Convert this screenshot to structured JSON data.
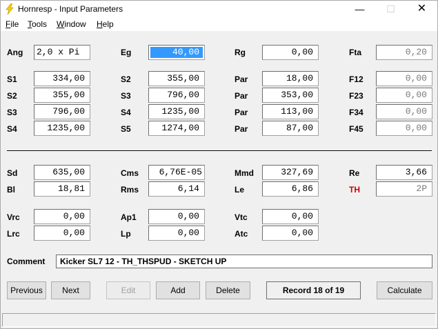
{
  "window": {
    "title": "Hornresp - Input Parameters",
    "min": "—",
    "max": "☐",
    "close": "✕"
  },
  "menu": [
    "File",
    "Tools",
    "Window",
    "Help"
  ],
  "rows": {
    "r1": [
      {
        "label": "Ang",
        "value": "2,0 x Pi"
      },
      {
        "label": "Eg",
        "value": "40,00"
      },
      {
        "label": "Rg",
        "value": "0,00"
      },
      {
        "label": "Fta",
        "value": "0,20"
      }
    ],
    "r2": [
      {
        "label": "S1",
        "value": "334,00"
      },
      {
        "label": "S2",
        "value": "355,00"
      },
      {
        "label": "Par",
        "value": "18,00"
      },
      {
        "label": "F12",
        "value": "0,00"
      }
    ],
    "r3": [
      {
        "label": "S2",
        "value": "355,00"
      },
      {
        "label": "S3",
        "value": "796,00"
      },
      {
        "label": "Par",
        "value": "353,00"
      },
      {
        "label": "F23",
        "value": "0,00"
      }
    ],
    "r4": [
      {
        "label": "S3",
        "value": "796,00"
      },
      {
        "label": "S4",
        "value": "1235,00"
      },
      {
        "label": "Par",
        "value": "113,00"
      },
      {
        "label": "F34",
        "value": "0,00"
      }
    ],
    "r5": [
      {
        "label": "S4",
        "value": "1235,00"
      },
      {
        "label": "S5",
        "value": "1274,00"
      },
      {
        "label": "Par",
        "value": "87,00"
      },
      {
        "label": "F45",
        "value": "0,00"
      }
    ],
    "r6": [
      {
        "label": "Sd",
        "value": "635,00"
      },
      {
        "label": "Cms",
        "value": "6,76E-05"
      },
      {
        "label": "Mmd",
        "value": "327,69"
      },
      {
        "label": "Re",
        "value": "3,66"
      }
    ],
    "r7": [
      {
        "label": "Bl",
        "value": "18,81"
      },
      {
        "label": "Rms",
        "value": "6,14"
      },
      {
        "label": "Le",
        "value": "6,86"
      },
      {
        "label": "TH",
        "value": "2P"
      }
    ],
    "r8": [
      {
        "label": "Vrc",
        "value": "0,00"
      },
      {
        "label": "Ap1",
        "value": "0,00"
      },
      {
        "label": "Vtc",
        "value": "0,00"
      }
    ],
    "r9": [
      {
        "label": "Lrc",
        "value": "0,00"
      },
      {
        "label": "Lp",
        "value": "0,00"
      },
      {
        "label": "Atc",
        "value": "0,00"
      }
    ]
  },
  "comment": {
    "label": "Comment",
    "value": "Kicker SL7 12 - TH_THSPUD - SKETCH UP"
  },
  "buttons": {
    "previous": "Previous",
    "next": "Next",
    "edit": "Edit",
    "add": "Add",
    "delete": "Delete",
    "calculate": "Calculate"
  },
  "record": "Record 18 of 19",
  "colors": {
    "selection": "#3399ff",
    "th_label": "#d00000"
  }
}
